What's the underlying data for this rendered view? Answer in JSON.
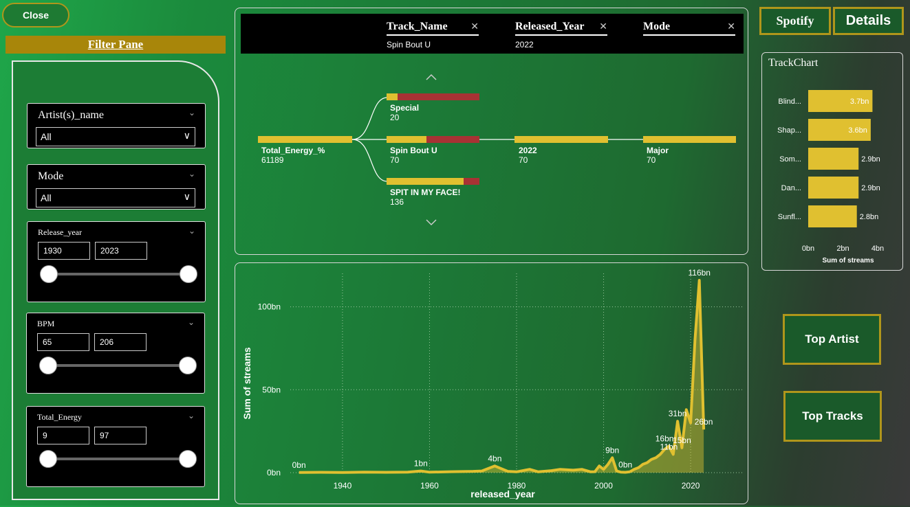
{
  "close_label": "Close",
  "filter_pane": {
    "title": "Filter Pane",
    "artist": {
      "title": "Artist(s)_name",
      "value": "All"
    },
    "mode": {
      "title": "Mode",
      "value": "All"
    },
    "release_year": {
      "title": "Release_year",
      "min": "1930",
      "max": "2023"
    },
    "bpm": {
      "title": "BPM",
      "min": "65",
      "max": "206"
    },
    "total_energy": {
      "title": "Total_Energy",
      "min": "9",
      "max": "97"
    }
  },
  "decomposition": {
    "headers": [
      {
        "title": "Track_Name",
        "value": "Spin Bout U"
      },
      {
        "title": "Released_Year",
        "value": "2022"
      },
      {
        "title": "Mode",
        "value": ""
      }
    ],
    "root": {
      "label": "Total_Energy_%",
      "value": "61189"
    },
    "level1": [
      {
        "label": "Special",
        "value": "20",
        "fill": 0.12
      },
      {
        "label": "Spin Bout U",
        "value": "70",
        "fill": 0.43
      },
      {
        "label": "SPIT IN MY FACE!",
        "value": "136",
        "fill": 0.83
      }
    ],
    "level2": {
      "label": "2022",
      "value": "70"
    },
    "level3": {
      "label": "Major",
      "value": "70"
    }
  },
  "nav": {
    "spotify": "Spotify",
    "details": "Details",
    "top_artist": "Top Artist",
    "top_tracks": "Top Tracks"
  },
  "colors": {
    "accent": "#e0c030",
    "gold_border": "#b0961b",
    "negative": "#a83234"
  },
  "chart_data": [
    {
      "type": "bar",
      "title": "TrackChart",
      "categories": [
        "Blind...",
        "Shap...",
        "Som...",
        "Dan...",
        "Sunfl..."
      ],
      "values": [
        3.7,
        3.6,
        2.9,
        2.9,
        2.8
      ],
      "data_labels": [
        "3.7bn",
        "3.6bn",
        "2.9bn",
        "2.9bn",
        "2.8bn"
      ],
      "xlabel": "Sum of streams",
      "xticks": [
        "0bn",
        "2bn",
        "4bn"
      ],
      "xlim": [
        0,
        4
      ]
    },
    {
      "type": "area",
      "xlabel": "released_year",
      "ylabel": "Sum of streams",
      "xlim": [
        1928,
        2032
      ],
      "ylim": [
        0,
        116
      ],
      "xticks": [
        1940,
        1960,
        1980,
        2000,
        2020
      ],
      "yticks": [
        {
          "v": 0,
          "label": "0bn"
        },
        {
          "v": 50,
          "label": "50bn"
        },
        {
          "v": 100,
          "label": "100bn"
        }
      ],
      "x": [
        1930,
        1935,
        1940,
        1945,
        1950,
        1955,
        1958,
        1960,
        1965,
        1970,
        1972,
        1975,
        1978,
        1980,
        1983,
        1985,
        1988,
        1990,
        1993,
        1995,
        1997,
        1998,
        1999,
        2000,
        2001,
        2002,
        2003,
        2004,
        2005,
        2006,
        2007,
        2008,
        2009,
        2010,
        2011,
        2012,
        2013,
        2014,
        2015,
        2016,
        2017,
        2018,
        2019,
        2020,
        2021,
        2022,
        2023
      ],
      "y": [
        0.1,
        0.2,
        0.1,
        0.3,
        0.2,
        0.3,
        1,
        0.3,
        0.6,
        0.8,
        1,
        4,
        0.8,
        0.5,
        2,
        0.5,
        1.2,
        2,
        1.5,
        2,
        0.5,
        0.6,
        4,
        2,
        5,
        9,
        1,
        0.3,
        0.2,
        0.5,
        2,
        3,
        5,
        6,
        8,
        9,
        11,
        14,
        16,
        11,
        31,
        15,
        38,
        30,
        80,
        116,
        26
      ],
      "data_labels": [
        {
          "x": 1930,
          "y": 0,
          "label": "0bn"
        },
        {
          "x": 1958,
          "y": 1,
          "label": "1bn"
        },
        {
          "x": 1975,
          "y": 4,
          "label": "4bn"
        },
        {
          "x": 2002,
          "y": 9,
          "label": "9bn"
        },
        {
          "x": 2005,
          "y": 0.3,
          "label": "0bn"
        },
        {
          "x": 2014,
          "y": 16,
          "label": "16bn"
        },
        {
          "x": 2015,
          "y": 11,
          "label": "11bn"
        },
        {
          "x": 2018,
          "y": 15,
          "label": "15bn"
        },
        {
          "x": 2017,
          "y": 31,
          "label": "31bn"
        },
        {
          "x": 2022,
          "y": 116,
          "label": "116bn"
        },
        {
          "x": 2023,
          "y": 26,
          "label": "26bn"
        }
      ]
    }
  ]
}
